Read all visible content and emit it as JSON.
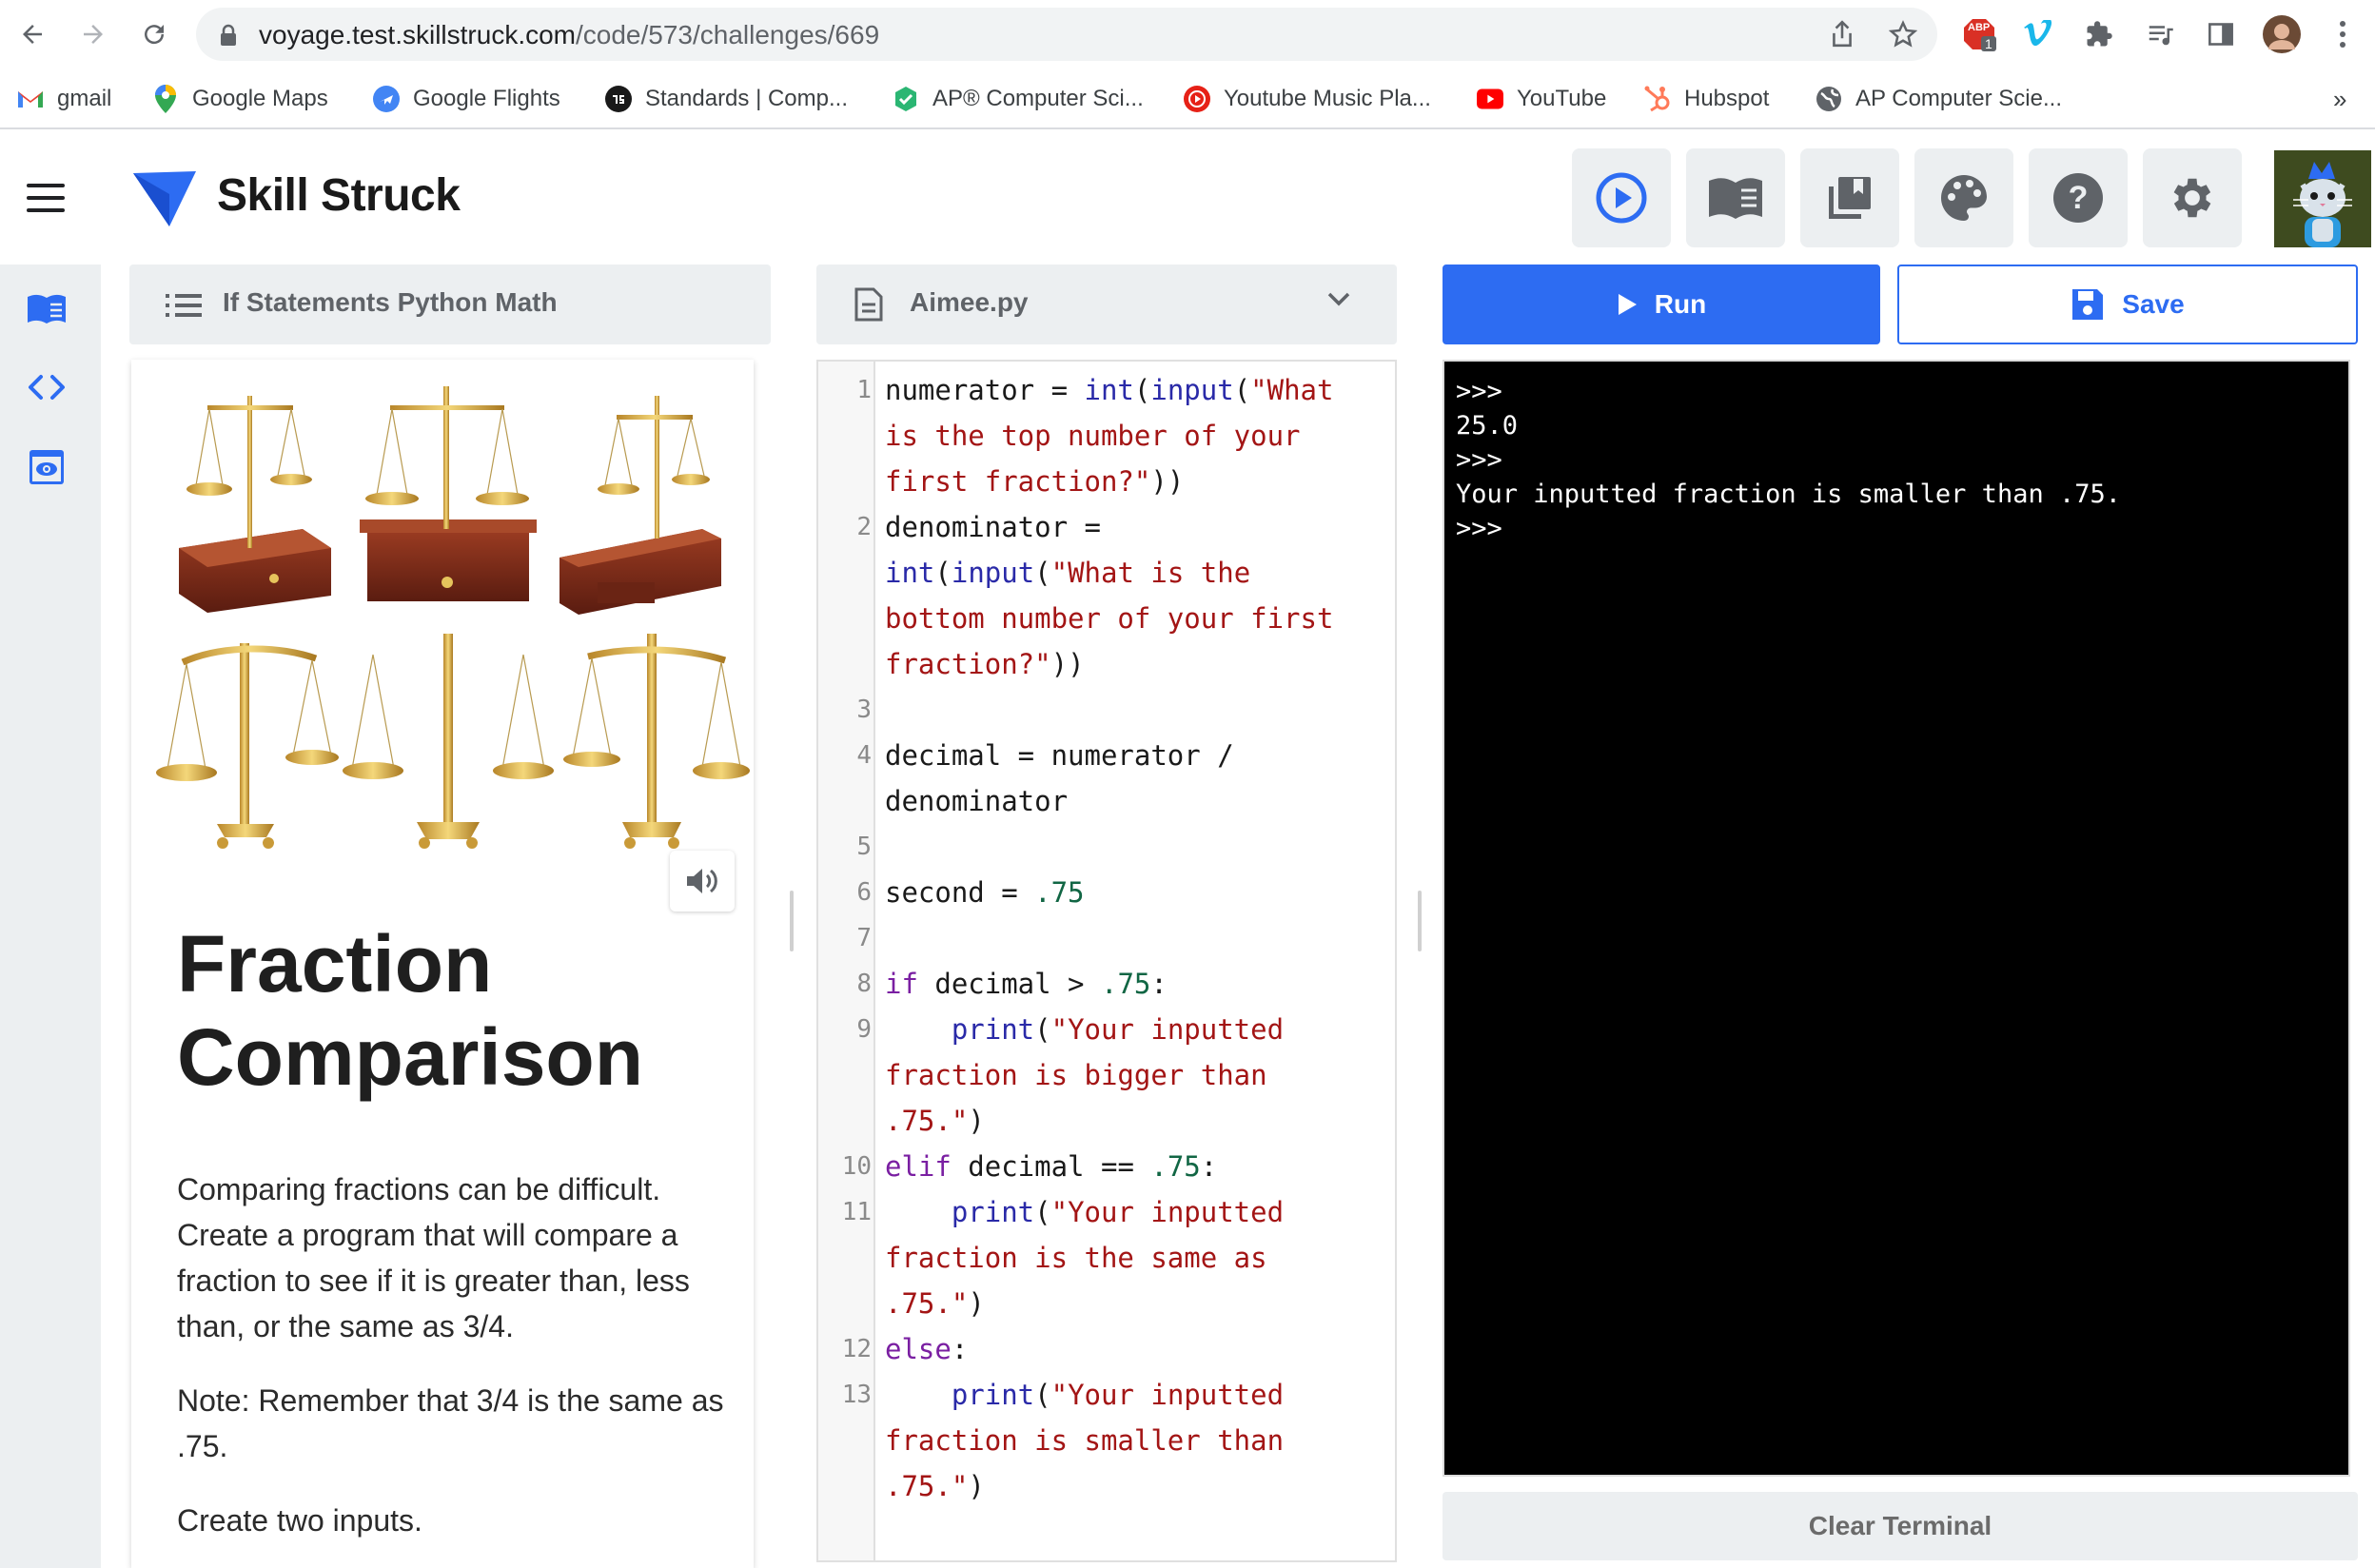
{
  "browser": {
    "url_host": "voyage.test.skillstruck.com",
    "url_path": "/code/573/challenges/669",
    "extension_badge": "1",
    "extension_badge_label": "ABP",
    "bookmarks": [
      {
        "label": "gmail",
        "icon": "gmail-icon"
      },
      {
        "label": "Google Maps",
        "icon": "map-pin-icon"
      },
      {
        "label": "Google Flights",
        "icon": "plane-icon"
      },
      {
        "label": "Standards | Comp...",
        "icon": "standards-icon"
      },
      {
        "label": "AP® Computer Sci...",
        "icon": "shield-check-icon"
      },
      {
        "label": "Youtube Music Pla...",
        "icon": "youtube-music-icon"
      },
      {
        "label": "YouTube",
        "icon": "youtube-icon"
      },
      {
        "label": "Hubspot",
        "icon": "hubspot-icon"
      },
      {
        "label": "AP Computer Scie...",
        "icon": "globe-icon"
      }
    ],
    "overflow": "»"
  },
  "app": {
    "brand": "Skill Struck",
    "brand_color": "#2d6cf2"
  },
  "lesson": {
    "header_title": "If Statements Python Math",
    "heading": "Fraction Comparison",
    "paragraphs": [
      "Comparing fractions can be difficult. Create a program that will compare a fraction to see if it is greater than, less than, or the same as 3/4.",
      "Note: Remember that 3/4 is the same as .75.",
      "Create two inputs."
    ]
  },
  "editor": {
    "file_name": "Aimee.py",
    "line_numbers": [
      "1",
      "2",
      "3",
      "4",
      "5",
      "6",
      "7",
      "8",
      "9",
      "10",
      "11",
      "12",
      "13"
    ]
  },
  "actions": {
    "run_label": "Run",
    "save_label": "Save",
    "clear_label": "Clear Terminal"
  },
  "terminal": {
    "lines": [
      ">>>",
      "25.0",
      ">>>",
      "Your inputted fraction is smaller than .75.",
      ">>>"
    ]
  }
}
